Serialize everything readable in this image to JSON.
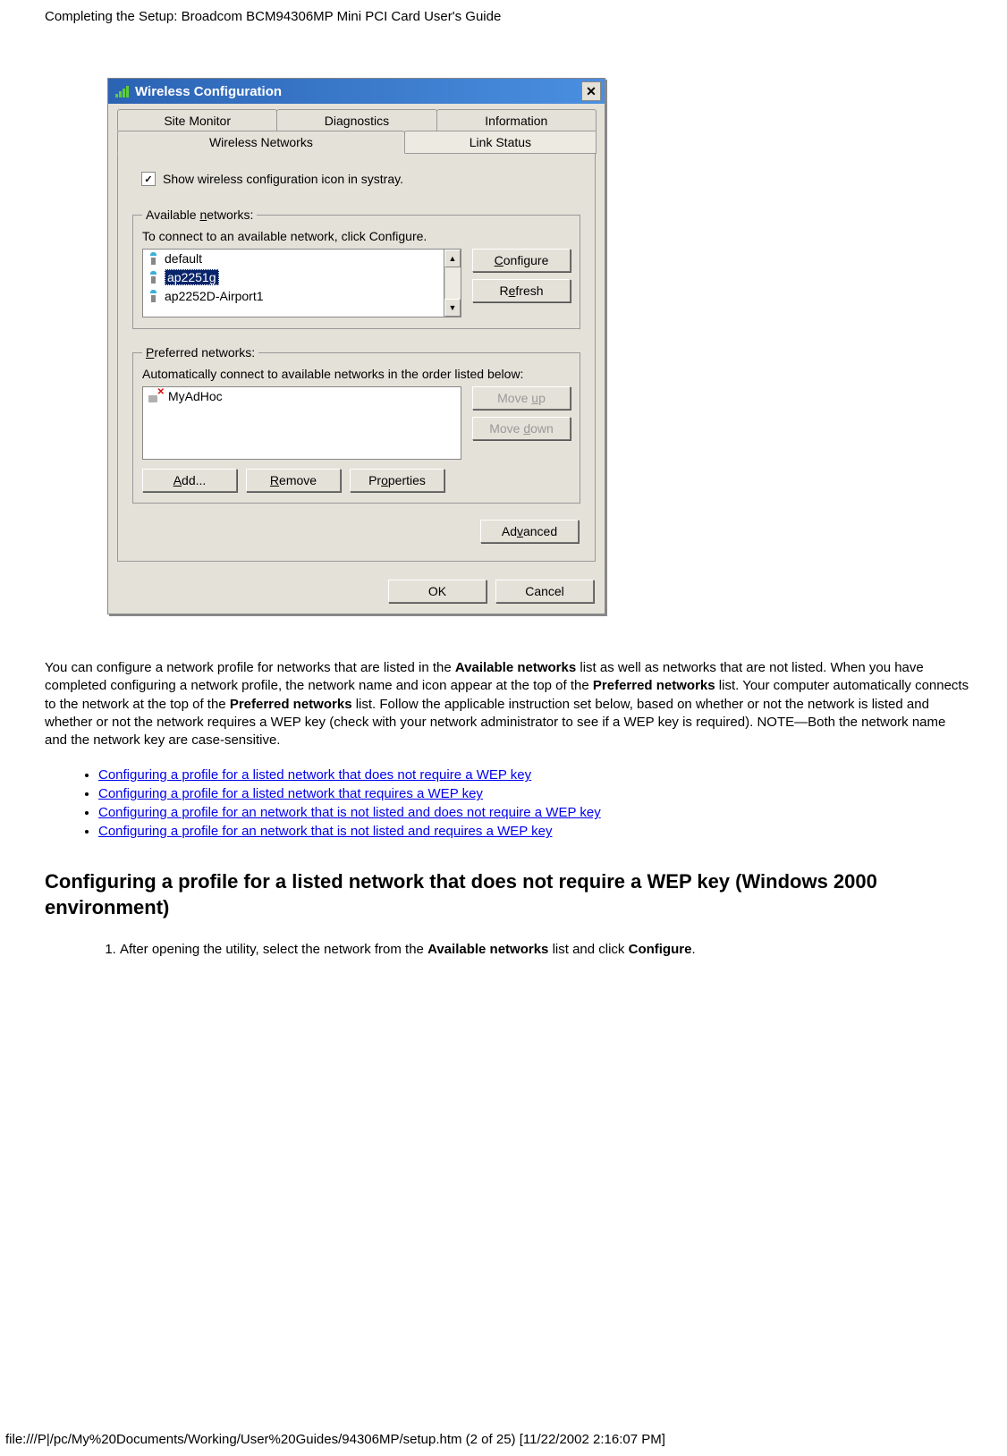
{
  "header": "Completing the Setup: Broadcom BCM94306MP Mini PCI Card User's Guide",
  "dialog": {
    "title": "Wireless Configuration",
    "tabs_top": [
      "Site Monitor",
      "Diagnostics",
      "Information"
    ],
    "tabs_bottom": [
      "Wireless Networks",
      "Link Status"
    ],
    "checkbox_label": "Show wireless configuration icon in systray.",
    "avail": {
      "legend_pre": "Available ",
      "legend_u": "n",
      "legend_post": "etworks:",
      "instr": "To connect to an available network, click Configure.",
      "items": [
        {
          "label": "default",
          "selected": false
        },
        {
          "label": "ap2251g",
          "selected": true
        },
        {
          "label": "ap2252D-Airport1",
          "selected": false
        }
      ],
      "btn_configure_u": "C",
      "btn_configure": "onfigure",
      "btn_refresh_pre": "R",
      "btn_refresh_u": "e",
      "btn_refresh_post": "fresh"
    },
    "pref": {
      "legend_u": "P",
      "legend_post": "referred networks:",
      "instr": "Automatically connect to available networks in the order listed below:",
      "item": "MyAdHoc",
      "moveup_pre": "Move ",
      "moveup_u": "u",
      "moveup_post": "p",
      "movedown_pre": "Move ",
      "movedown_u": "d",
      "movedown_post": "own",
      "add_u": "A",
      "add_post": "dd...",
      "remove_u": "R",
      "remove_post": "emove",
      "properties_pre": "Pr",
      "properties_u": "o",
      "properties_post": "perties"
    },
    "advanced_pre": "Ad",
    "advanced_u": "v",
    "advanced_post": "anced",
    "ok": "OK",
    "cancel": "Cancel"
  },
  "paragraph": {
    "p1a": "You can configure a network profile for networks that are listed in the ",
    "p1b": "Available networks",
    "p1c": " list as well as networks that are not listed. When you have completed configuring a network profile, the network name and icon appear at the top of the ",
    "p1d": "Preferred networks",
    "p1e": " list. Your computer automatically connects to the network at the top of the ",
    "p1f": "Preferred networks",
    "p1g": " list. Follow the applicable instruction set below, based on whether or not the network is listed and whether or not the network requires a WEP key (check with your network administrator to see if a WEP key is required). NOTE—Both the network name and the network key are case-sensitive."
  },
  "links": [
    "Configuring a profile for a listed network that does not require a WEP key",
    "Configuring a profile for a listed network that requires a WEP key",
    "Configuring a profile for an network that is not listed and does not require a WEP key",
    "Configuring a profile for an network that is not listed and requires a WEP key"
  ],
  "section_heading": "Configuring a profile for a listed network that does not require a WEP key (Windows 2000 environment)",
  "step1_a": "After opening the utility, select the network from the ",
  "step1_b": "Available networks",
  "step1_c": " list and click ",
  "step1_d": "Configure",
  "step1_e": ".",
  "footer": "file:///P|/pc/My%20Documents/Working/User%20Guides/94306MP/setup.htm (2 of 25) [11/22/2002 2:16:07 PM]"
}
